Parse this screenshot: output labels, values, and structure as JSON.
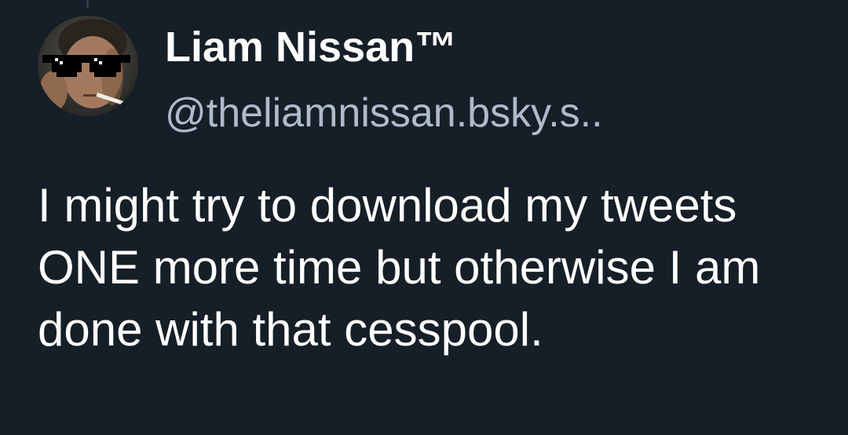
{
  "post": {
    "author": {
      "display_name": "Liam Nissan™",
      "handle": "@theliamnissan.bsky.s.."
    },
    "text": "I might try to download my tweets ONE more time but otherwise I am done with that cesspool."
  },
  "colors": {
    "background": "#161e27",
    "name": "#ffffff",
    "handle": "#aebbcb",
    "text": "#ffffff"
  }
}
